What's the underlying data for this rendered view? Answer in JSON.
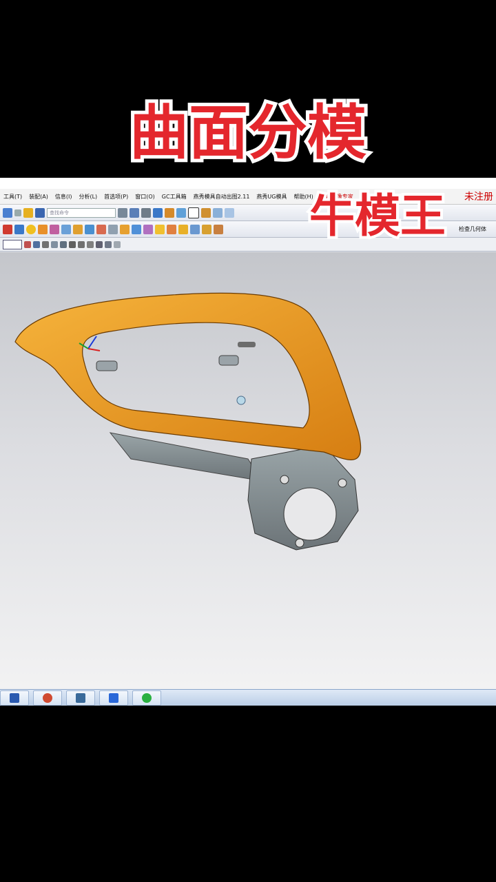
{
  "overlay": {
    "title": "曲面分模",
    "watermark": "牛模王"
  },
  "menu": {
    "items": [
      "工具(T)",
      "装配(A)",
      "信息(I)",
      "分析(L)",
      "首选项(P)",
      "窗口(O)",
      "GC工具箱",
      "燕秀模具自动出图2.11",
      "燕秀UG模具",
      "帮助(H)",
      "屏幕录像专家"
    ],
    "registration": "未注册"
  },
  "toolbar": {
    "search_placeholder": "查找命令",
    "check_geometry_label": "检查几何体"
  },
  "taskbar": {
    "apps": [
      "shield-app",
      "browser-app",
      "editor-app",
      "wps-app",
      "wechat-app"
    ]
  },
  "colors": {
    "part_orange": "#f0a020",
    "part_grey": "#8a9498",
    "title_red": "#e8282d"
  }
}
